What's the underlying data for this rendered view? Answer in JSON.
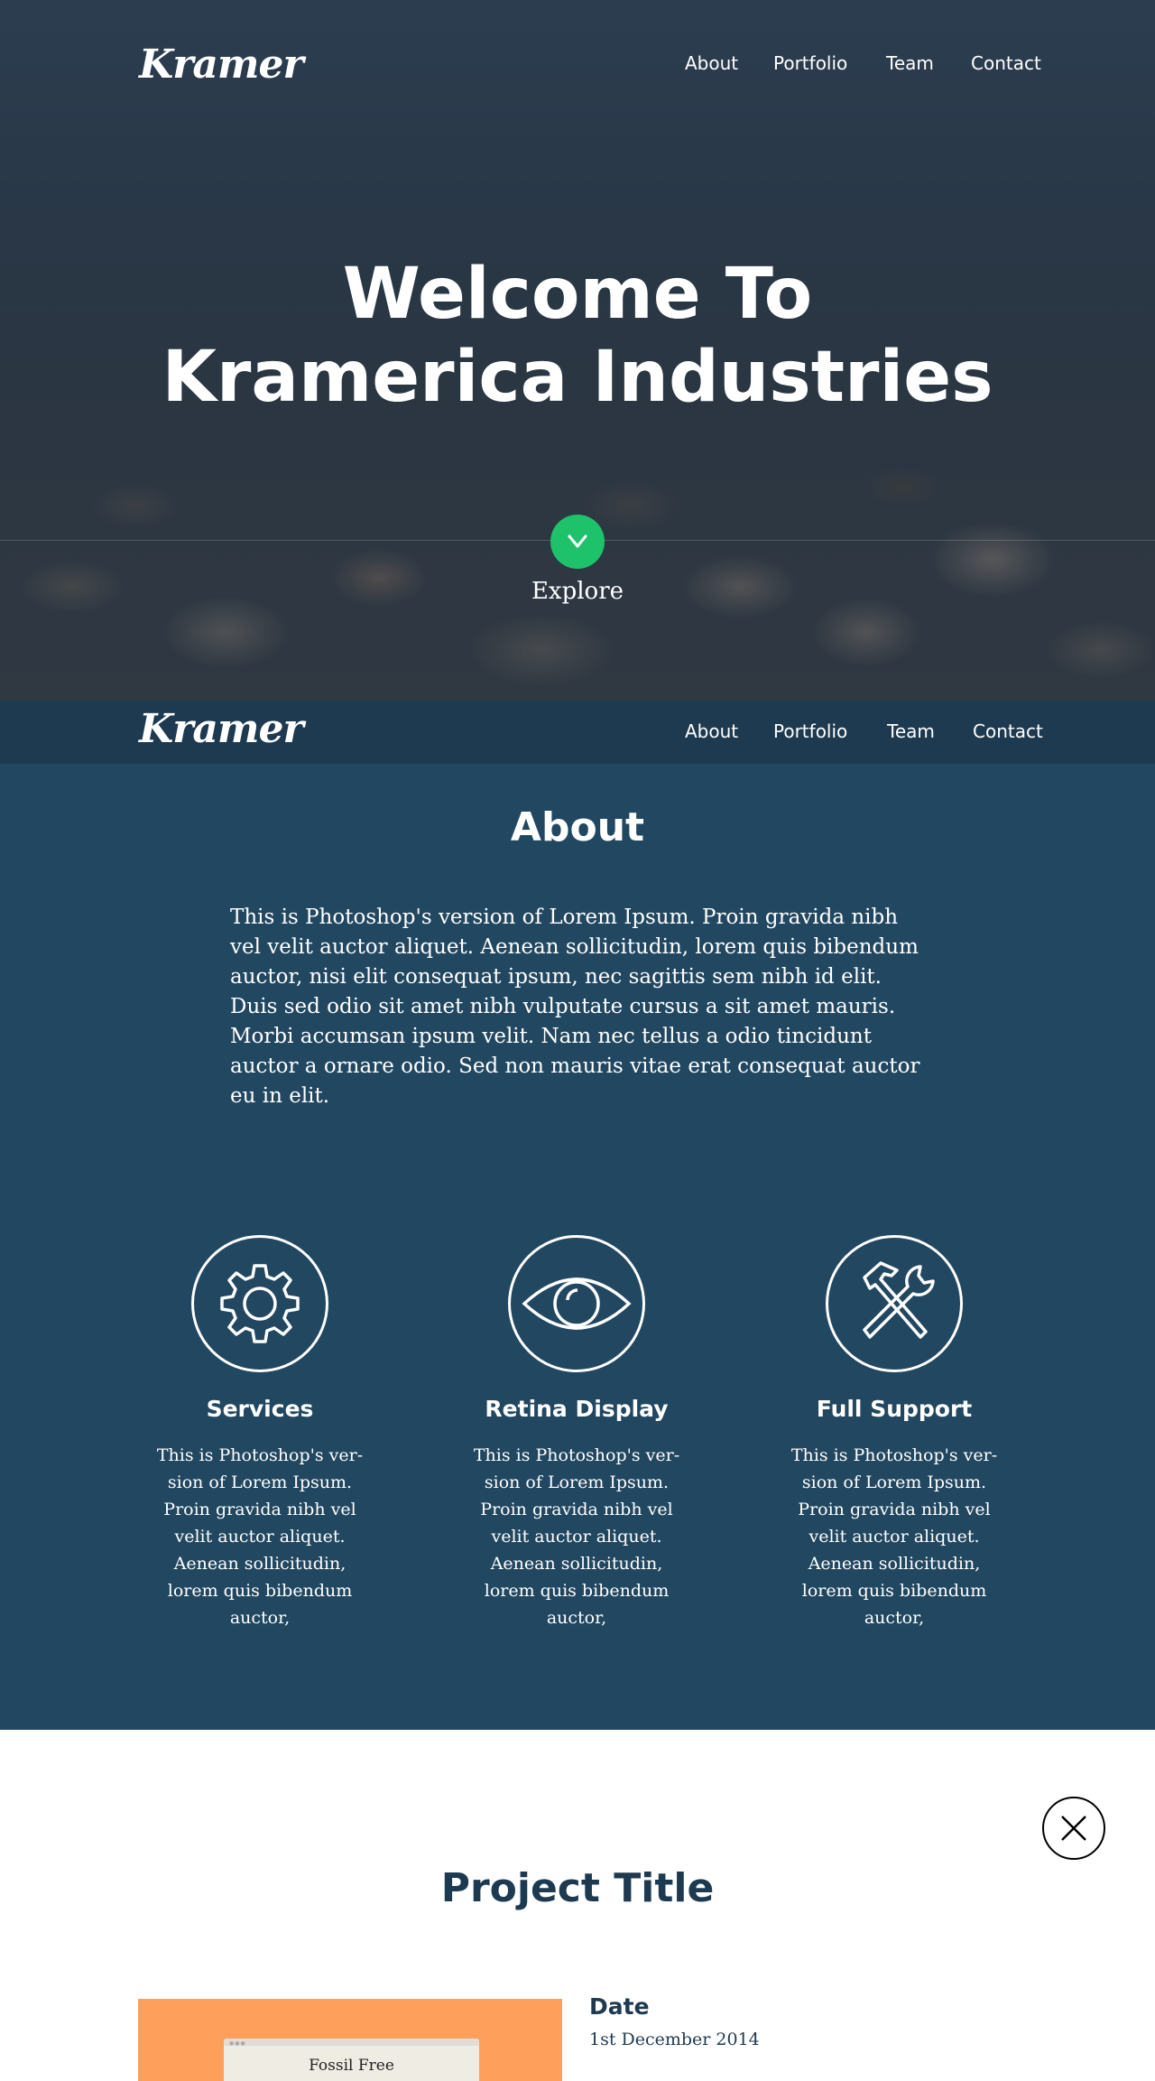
{
  "brand": {
    "logo": "Kramer"
  },
  "nav": {
    "items": [
      {
        "label": "About"
      },
      {
        "label": "Portfolio"
      },
      {
        "label": "Team"
      },
      {
        "label": "Contact"
      }
    ]
  },
  "hero": {
    "title_line1": "Welcome To",
    "title_line2": "Kramerica Industries",
    "explore_label": "Explore",
    "accent_color": "#1ec26a"
  },
  "about": {
    "title": "About",
    "body": "This is Photoshop's version  of Lorem Ipsum. Proin gravida nibh vel velit auctor aliquet. Aenean sollicitudin, lorem quis bibendum auctor, nisi elit consequat ipsum, nec sagittis sem nibh id elit. Duis sed odio sit amet nibh vulputate cursus a sit amet mauris. Morbi accumsan ipsum velit. Nam nec tellus a odio tincidunt auctor a ornare odio. Sed non  mauris vitae erat consequat auctor eu in elit.",
    "background_color": "#224760",
    "features": [
      {
        "icon": "gear-icon",
        "title": "Services",
        "text": "This is Photoshop's ver- sion  of Lorem Ipsum. Proin gravida nibh vel velit auctor aliquet. Aenean sollicitudin, lorem quis bibendum auctor,"
      },
      {
        "icon": "eye-icon",
        "title": "Retina Display",
        "text": "This is Photoshop's ver- sion  of Lorem Ipsum. Proin gravida nibh vel velit auctor aliquet. Aenean sollicitudin, lorem quis bibendum auctor,"
      },
      {
        "icon": "tools-icon",
        "title": "Full Support",
        "text": "This is Photoshop's ver- sion  of Lorem Ipsum. Proin gravida nibh vel velit auctor aliquet. Aenean sollicitudin, lorem quis bibendum auctor,"
      }
    ]
  },
  "project": {
    "title": "Project Title",
    "image_text": "Fossil Free",
    "date_label": "Date",
    "date_value": "1st December 2014",
    "title_color": "#1e3a50"
  }
}
